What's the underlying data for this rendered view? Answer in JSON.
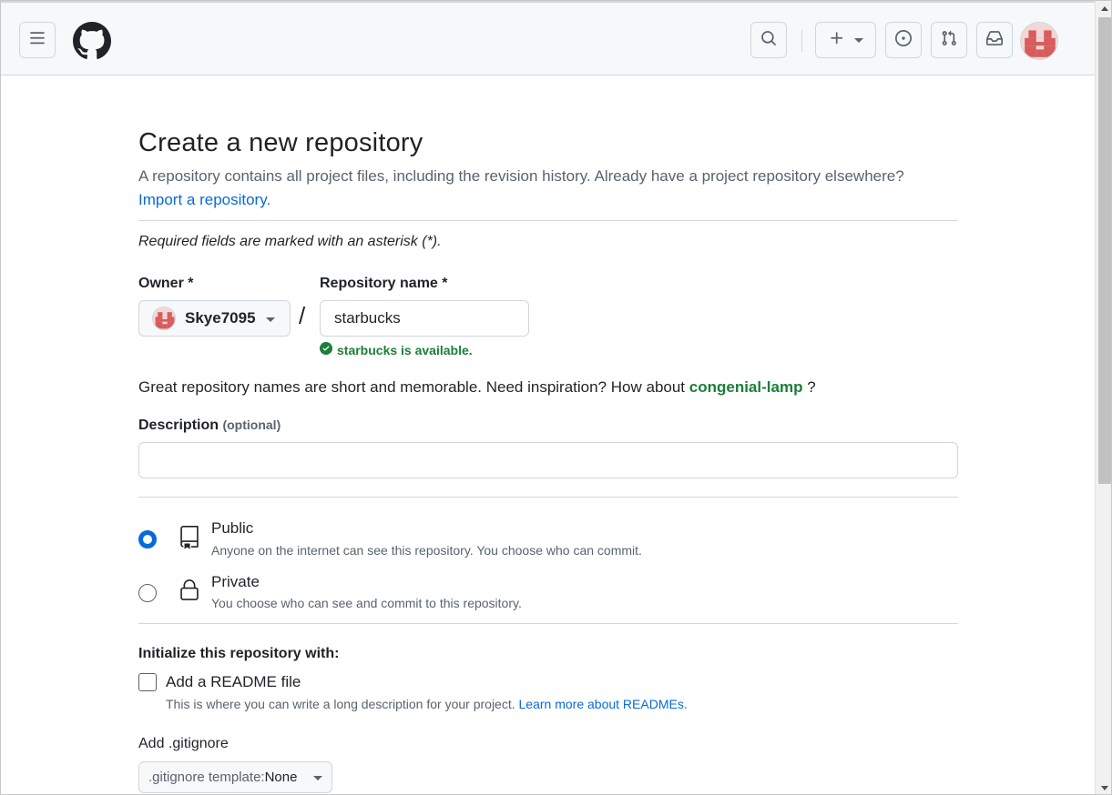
{
  "header": {
    "menu_icon": "hamburger-icon",
    "logo_icon": "github-logo",
    "search_icon": "search-icon",
    "create_icon": "plus-icon",
    "issues_icon": "issue-opened-icon",
    "pull_requests_icon": "git-pull-request-icon",
    "inbox_icon": "inbox-icon",
    "avatar_icon": "user-avatar"
  },
  "page": {
    "title": "Create a new repository",
    "subtitle": "A repository contains all project files, including the revision history. Already have a project repository elsewhere?",
    "import_link": "Import a repository.",
    "required_note": "Required fields are marked with an asterisk (*)."
  },
  "owner": {
    "label": "Owner *",
    "value": "Skye7095"
  },
  "slash": "/",
  "repo_name": {
    "label": "Repository name *",
    "value": "starbucks",
    "availability": "starbucks is available."
  },
  "inspiration": {
    "text": "Great repository names are short and memorable. Need inspiration? How about",
    "suggestion": "congenial-lamp",
    "suffix": "?"
  },
  "description": {
    "label": "Description",
    "optional": "(optional)",
    "value": ""
  },
  "visibility": {
    "selected": "public",
    "public": {
      "title": "Public",
      "desc": "Anyone on the internet can see this repository. You choose who can commit."
    },
    "private": {
      "title": "Private",
      "desc": "You choose who can see and commit to this repository."
    }
  },
  "init": {
    "title": "Initialize this repository with:",
    "readme_label": "Add a README file",
    "readme_checked": false,
    "readme_desc": "This is where you can write a long description for your project.",
    "readme_link": "Learn more about READMEs."
  },
  "gitignore": {
    "label": "Add .gitignore",
    "prefix": ".gitignore template:",
    "value": "None"
  },
  "colors": {
    "accent": "#0969da",
    "success": "#1a7f37",
    "header_bg": "#f6f8fa",
    "border": "#d0d7de"
  }
}
